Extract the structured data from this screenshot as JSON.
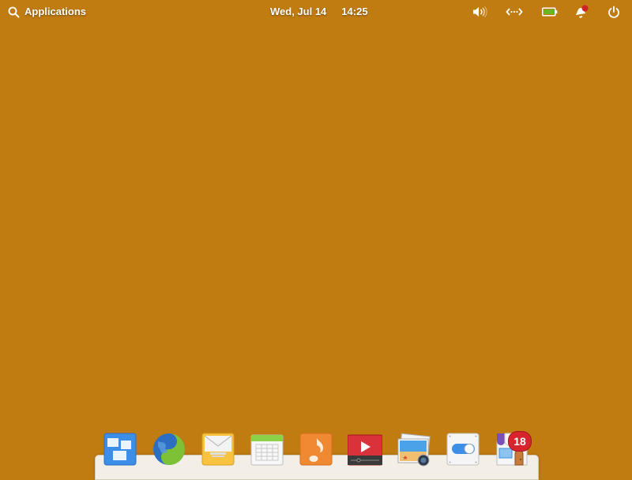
{
  "panel": {
    "applications_label": "Applications",
    "date": "Wed, Jul 14",
    "time": "14:25",
    "indicators": [
      {
        "name": "sound-indicator",
        "icon": "volume-icon"
      },
      {
        "name": "network-indicator",
        "icon": "network-wired-icon"
      },
      {
        "name": "power-indicator",
        "icon": "battery-icon"
      },
      {
        "name": "notifications-indicator",
        "icon": "notification-bell-icon",
        "has_unread": true
      },
      {
        "name": "session-indicator",
        "icon": "power-icon"
      }
    ]
  },
  "desktop": {
    "background_color": "#c17c11"
  },
  "dock": {
    "items": [
      {
        "name": "Multitasking View",
        "icon": "multitasking-view-icon"
      },
      {
        "name": "Web Browser",
        "icon": "web-browser-icon"
      },
      {
        "name": "Mail",
        "icon": "mail-icon"
      },
      {
        "name": "Calendar",
        "icon": "calendar-icon"
      },
      {
        "name": "Music",
        "icon": "music-icon"
      },
      {
        "name": "Videos",
        "icon": "videos-icon"
      },
      {
        "name": "Photos",
        "icon": "photos-icon"
      },
      {
        "name": "System Settings",
        "icon": "settings-toggle-icon"
      },
      {
        "name": "AppCenter",
        "icon": "appcenter-icon",
        "badge": "18"
      }
    ]
  }
}
